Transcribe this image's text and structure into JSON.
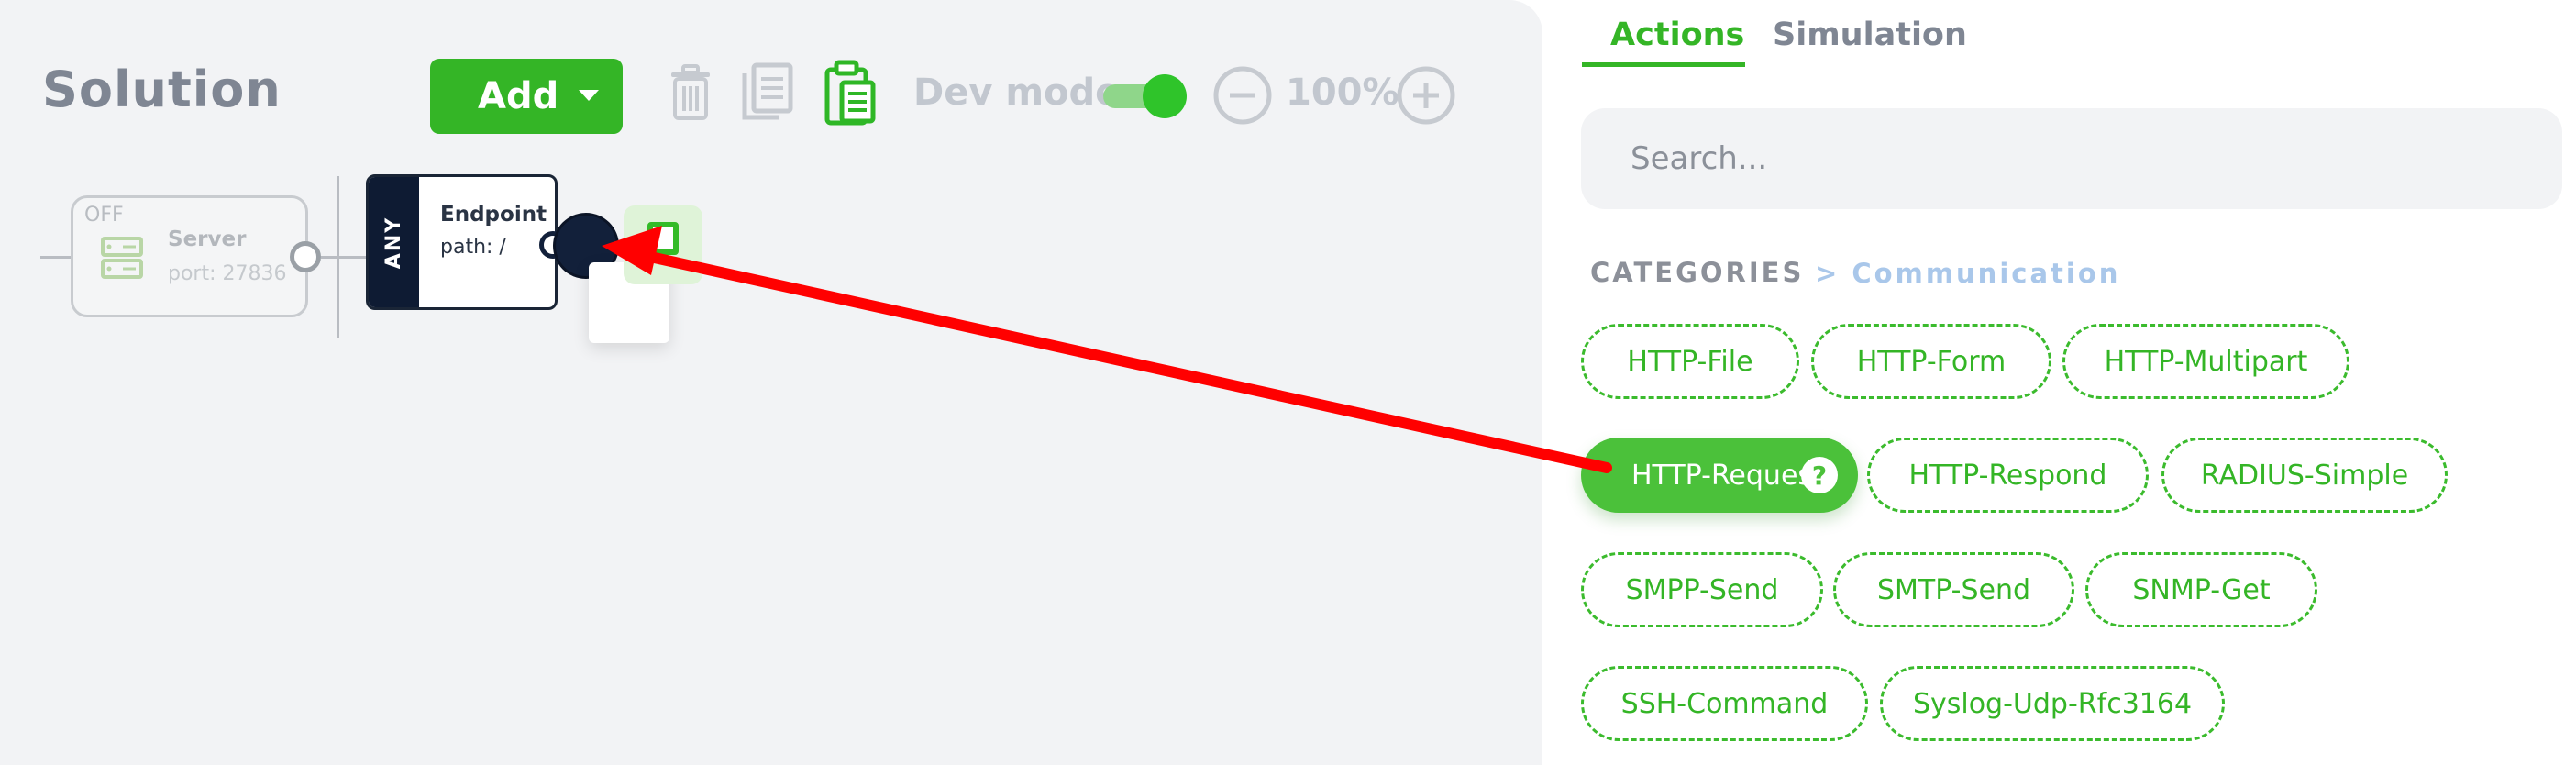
{
  "canvas": {
    "title": "Solution",
    "add_label": "Add",
    "devmode_label": "Dev mode",
    "devmode_on": true,
    "zoom_level": "100%"
  },
  "nodes": {
    "server": {
      "state": "OFF",
      "label": "Server",
      "port": "port: 27836"
    },
    "endpoint": {
      "method": "ANY",
      "label": "Endpoint",
      "path": "path: /"
    }
  },
  "panel": {
    "tabs": [
      {
        "label": "Actions",
        "active": true
      },
      {
        "label": "Simulation",
        "active": false
      }
    ],
    "search_placeholder": "Search...",
    "categories_label": "CATEGORIES",
    "breadcrumb": "> Communication",
    "chips": [
      {
        "label": "HTTP-File"
      },
      {
        "label": "HTTP-Form"
      },
      {
        "label": "HTTP-Multipart"
      },
      {
        "label": "HTTP-Reques",
        "active": true,
        "help": "?"
      },
      {
        "label": "HTTP-Respond"
      },
      {
        "label": "RADIUS-Simple"
      },
      {
        "label": "SMPP-Send"
      },
      {
        "label": "SMTP-Send"
      },
      {
        "label": "SNMP-Get"
      },
      {
        "label": "SSH-Command"
      },
      {
        "label": "Syslog-Udp-Rfc3164"
      }
    ]
  },
  "colors": {
    "accent_green": "#34b526",
    "annotation_arrow": "#ff0000",
    "node_dark": "#0e1b33"
  }
}
